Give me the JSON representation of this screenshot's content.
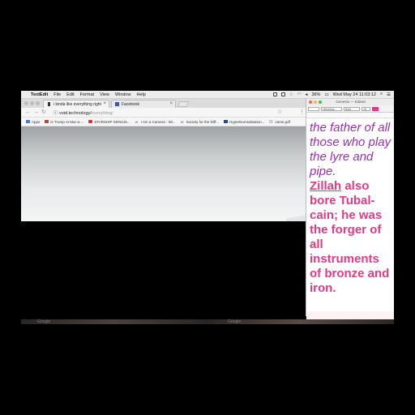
{
  "menubar": {
    "app": "TextEdit",
    "items": [
      "File",
      "Edit",
      "Format",
      "View",
      "Window",
      "Help"
    ],
    "battery": "36%",
    "clock": "Wed May 24 11:03:12"
  },
  "browser": {
    "tabs": [
      {
        "title": "i kinda like everything right",
        "close": "×"
      },
      {
        "title": "Facebook",
        "close": "×"
      }
    ],
    "url_domain": "void.technology/",
    "url_path": "everything/",
    "bookmarks": [
      {
        "label": "Apps",
        "color": "#4a7bd0"
      },
      {
        "label": "Is Trump At Mar-a-...",
        "color": "#b54636"
      },
      {
        "label": "STARSHIP GENIUS...",
        "color": "#e0302a"
      },
      {
        "label": "I Am a Camera - Wi...",
        "color": "#777777"
      },
      {
        "label": "Society for the Diff...",
        "color": "#777777"
      },
      {
        "label": "HyperNormalisation...",
        "color": "#2b4a7a"
      },
      {
        "label": "zarse.pdf",
        "color": "#999999"
      }
    ],
    "bottom_ghost": [
      "Google",
      "Google"
    ]
  },
  "textedit": {
    "title": "Genesis — Edited",
    "font": "Helvetica",
    "style": "Bold",
    "size": "18",
    "paragraph1": "the father of all those who play the lyre and pipe.",
    "name_underlined": "Zillah",
    "paragraph2_rest": " also bore Tubal-cain; he was the forger of all instruments of bronze and iron.",
    "colors": {
      "italic_purple": "#9b2fb5",
      "bold_pink": "#e33a86"
    }
  }
}
